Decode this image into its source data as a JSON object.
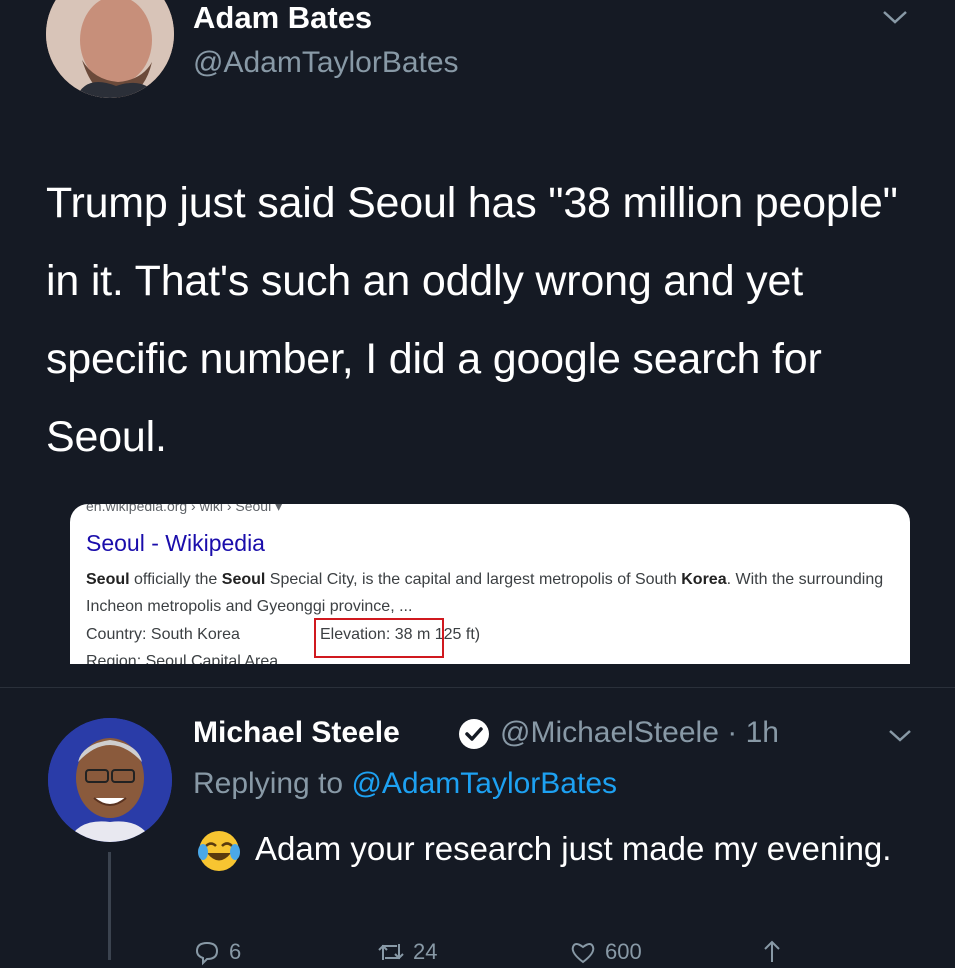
{
  "tweet": {
    "author_name": "Adam Bates",
    "author_handle": "@AdamTaylorBates",
    "text": "Trump just said Seoul has \"38 million people\" in it. That's such an oddly wrong and yet specific number, I did a google search for Seoul.",
    "menu_icon": "chevron-down-icon"
  },
  "search_card": {
    "url": "en.wikipedia.org › wiki › Seoul ▾",
    "title": "Seoul - Wikipedia",
    "snippet": {
      "p1": "Seoul",
      "p2": " officially the ",
      "p3": "Seoul",
      "p4": " Special City, is the capital and largest metropolis of South ",
      "p5": "Korea",
      "p6": ". With the surrounding Incheon metropolis and Gyeonggi province, ..."
    },
    "country_label": "Country:",
    "country_value": "South Korea",
    "elevation_label": "Elevation:",
    "elevation_value": "38 m",
    "elevation_feet": "125 ft)",
    "region_label": "Region:",
    "region_value": "Seoul Capital Area",
    "highlight_color": "#d0191f"
  },
  "reply": {
    "author_name": "Michael Steele",
    "author_handle": "@MichaelSteele",
    "separator": " · ",
    "time": "1h",
    "replying_prefix": "Replying to ",
    "replying_to": "@AdamTaylorBates",
    "text": "Adam your research just made my evening.",
    "emoji": "face-with-tears-of-joy",
    "actions": {
      "replies": "6",
      "retweets": "24",
      "likes": "600"
    }
  },
  "colors": {
    "background": "#151a24",
    "secondary_text": "#8899a6",
    "link": "#1da1f2"
  }
}
